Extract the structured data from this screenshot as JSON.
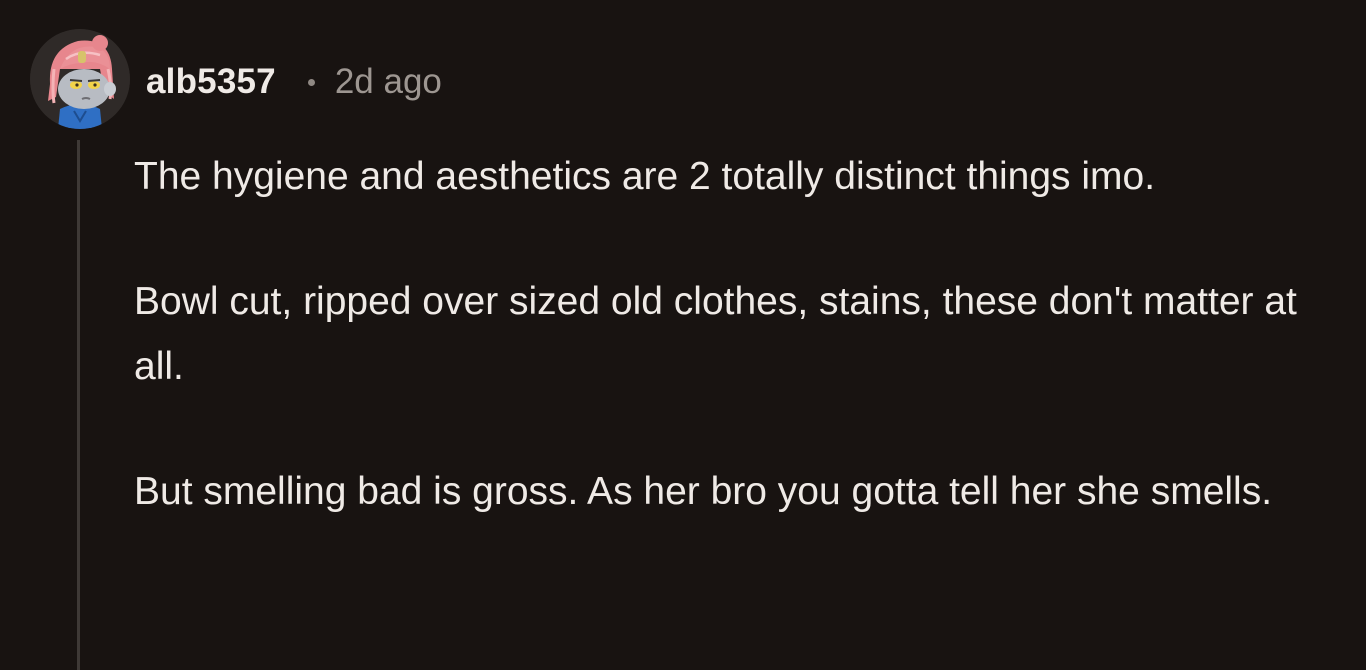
{
  "comment": {
    "author": "alb5357",
    "separator": "•",
    "time_ago": "2d ago",
    "paragraphs": [
      "The hygiene and aesthetics are 2 totally distinct things imo.",
      "Bowl cut, ripped over sized old clothes, stains, these don't matter at all.",
      "But smelling bad is gross. As her bro you gotta tell her she smells."
    ]
  },
  "colors": {
    "background": "#181311",
    "text": "#efeae6",
    "muted": "#9d9691",
    "thread_line": "#3e3936"
  },
  "avatar": {
    "icon": "user-avatar-icon"
  }
}
